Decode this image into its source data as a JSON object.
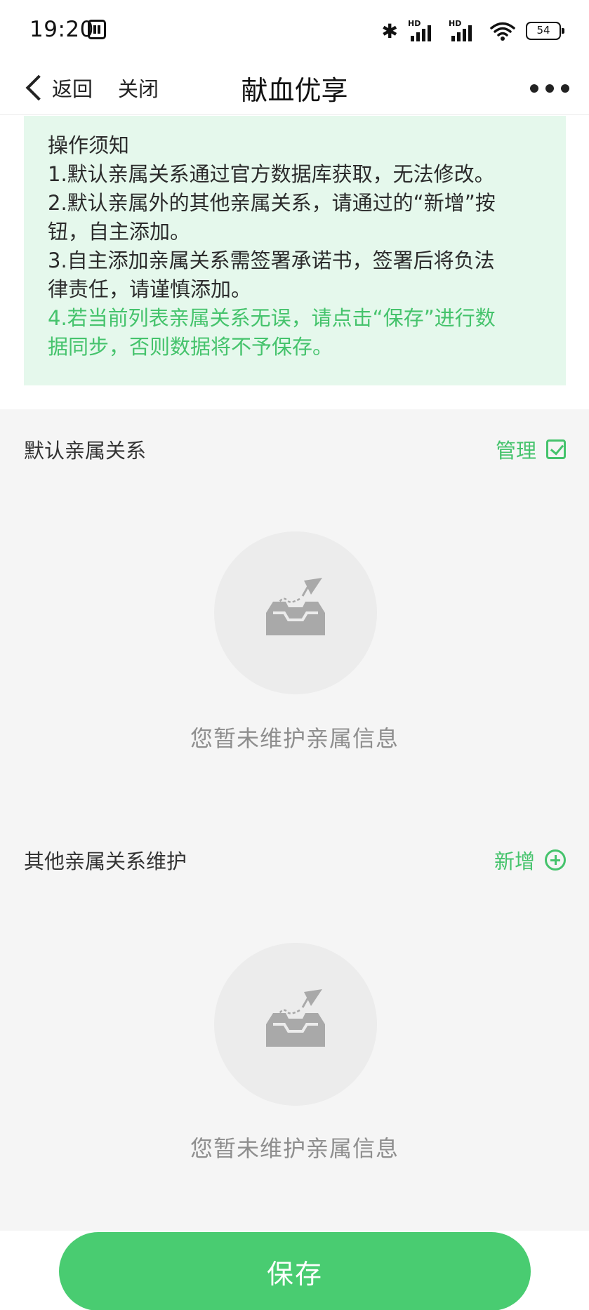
{
  "status_bar": {
    "time": "19:20",
    "hd_label": "HD",
    "battery": "54"
  },
  "nav": {
    "back_label": "返回",
    "close_label": "关闭",
    "title": "献血优享"
  },
  "notice": {
    "heading": "操作须知",
    "line1": "1.默认亲属关系通过官方数据库获取，无法修改。",
    "line2a": "2.默认亲属外的其他亲属关系，请通过的“新增”按",
    "line2b": "钮，自主添加。",
    "line3a": "3.自主添加亲属关系需签署承诺书，签署后将负法",
    "line3b": "律责任，请谨慎添加。",
    "line4a": "4.若当前列表亲属关系无误，请点击“保存”进行数",
    "line4b": "据同步，否则数据将不予保存。"
  },
  "default_section": {
    "title": "默认亲属关系",
    "action_label": "管理",
    "empty_text": "您暂未维护亲属信息"
  },
  "other_section": {
    "title": "其他亲属关系维护",
    "action_label": "新增",
    "empty_text": "您暂未维护亲属信息"
  },
  "save_label": "保存",
  "colors": {
    "accent": "#49cc71",
    "accent_text": "#45c36c",
    "notice_bg": "#e5f8ec",
    "content_bg": "#f5f5f5"
  }
}
